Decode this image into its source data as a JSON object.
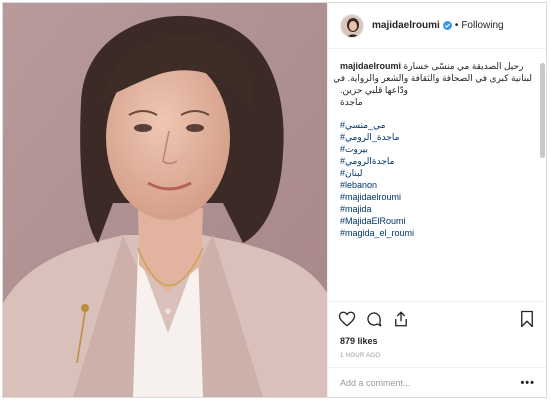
{
  "post": {
    "username": "majidaelroumi",
    "follow_label": "Following",
    "separator": "•"
  },
  "caption": {
    "username": "majidaelroumi",
    "line1": "رحيل الصديقة مي منسّى خسارة",
    "line2": "لبنانية كبرى في الصحافة والثقافة والشعر والرواية. في",
    "line3": "ودّاعها قلبي حزين.",
    "line4": "ماجدة",
    "hashtags": [
      "#مي_منسي",
      "#ماجدة_الرومي",
      "#بيروت",
      "#ماجدةالرومي",
      "#لبنان",
      "#lebanon",
      "#majidaelroumi",
      "#majida",
      "#MajidaElRoumi",
      "#magida_el_roumi"
    ]
  },
  "engagement": {
    "likes": "879 likes",
    "timestamp": "1 HOUR AGO"
  },
  "comment": {
    "placeholder": "Add a comment...",
    "more": "•••"
  },
  "icons": {
    "like": "heart-icon",
    "comment": "comment-icon",
    "share": "share-icon",
    "save": "bookmark-icon",
    "verified": "verified-badge-icon"
  },
  "colors": {
    "verified": "#3897f0",
    "hashtag": "#003569",
    "text": "#262626",
    "muted": "#999999"
  }
}
